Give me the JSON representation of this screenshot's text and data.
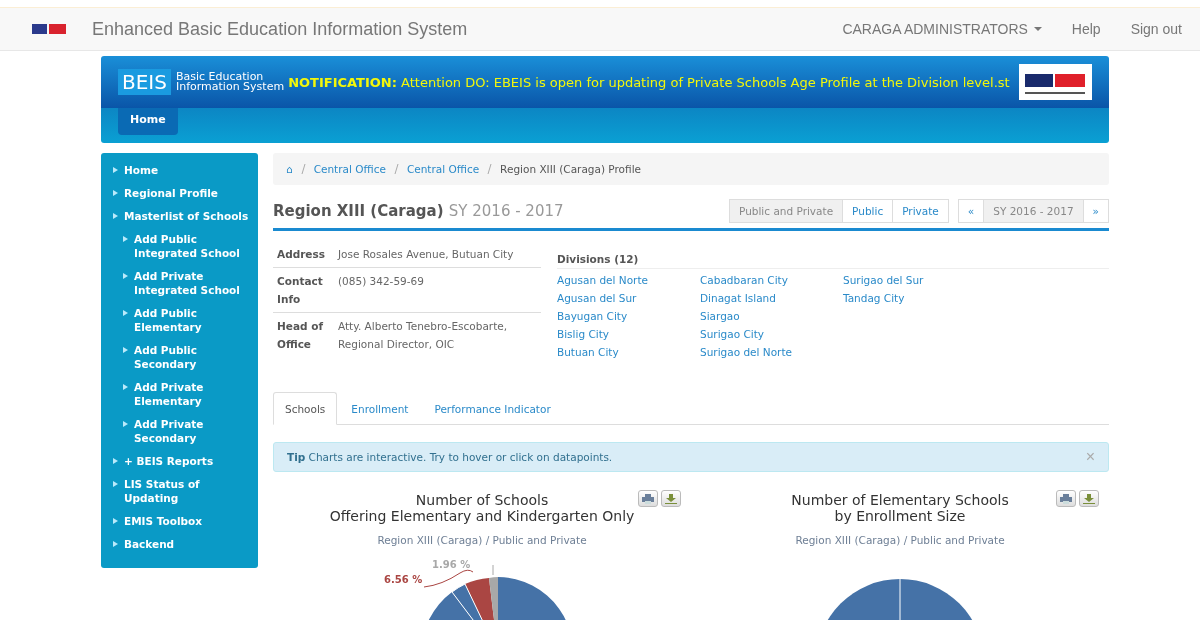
{
  "navbar": {
    "title": "Enhanced Basic Education Information System",
    "user_menu": "CARAGA ADMINISTRATORS",
    "links": [
      "Help",
      "Sign out"
    ]
  },
  "banner": {
    "brand": "BEIS",
    "brand_subtitle": [
      "Basic Education",
      "Information System"
    ],
    "notification": "**NOTIFICATION:** Attention DO: EBEIS is open for updating of Private Schools Age Profile at the Division level.st",
    "nav": [
      {
        "label": "Home",
        "selected": true
      }
    ]
  },
  "sidebar": {
    "items": [
      {
        "label": "Home"
      },
      {
        "label": "Regional Profile"
      },
      {
        "label": "Masterlist of Schools",
        "children": [
          {
            "label": "Add Public Integrated School"
          },
          {
            "label": "Add Private Integrated School"
          },
          {
            "label": "Add Public Elementary"
          },
          {
            "label": "Add Public Secondary"
          },
          {
            "label": "Add Private Elementary"
          },
          {
            "label": "Add Private Secondary"
          }
        ]
      },
      {
        "label": "+ BEIS Reports"
      },
      {
        "label": "LIS Status of Updating"
      },
      {
        "label": "EMIS Toolbox"
      },
      {
        "label": "Backend"
      }
    ]
  },
  "breadcrumb": [
    "⌂",
    "Central Office",
    "Central Office",
    "Region XIII (Caraga) Profile"
  ],
  "heading": {
    "title": "Region XIII (Caraga)",
    "subtitle": "SY 2016 - 2017"
  },
  "sector_filter": [
    {
      "label": "Public and Private",
      "selected": true
    },
    {
      "label": "Public",
      "selected": false
    },
    {
      "label": "Private",
      "selected": false
    }
  ],
  "year_pager": {
    "prev": "«",
    "current": "SY 2016 - 2017",
    "next": "»"
  },
  "profile": [
    {
      "label": "Address",
      "value": "Jose Rosales Avenue, Butuan City"
    },
    {
      "label": "Contact Info",
      "value": "(085) 342-59-69"
    },
    {
      "label": "Head of Office",
      "value": "Atty. Alberto Tenebro-Escobarte, Regional Director, OIC"
    }
  ],
  "divisions": {
    "title": "Divisions (12)",
    "items": [
      "Agusan del Norte",
      "Agusan del Sur",
      "Bayugan City",
      "Bislig City",
      "Butuan City",
      "Cabadbaran City",
      "Dinagat Island",
      "Siargao",
      "Surigao City",
      "Surigao del Norte",
      "Surigao del Sur",
      "Tandag City"
    ]
  },
  "tabs": [
    {
      "label": "Schools",
      "selected": true
    },
    {
      "label": "Enrollment",
      "selected": false
    },
    {
      "label": "Performance Indicator",
      "selected": false
    }
  ],
  "tip": {
    "text": "**Tip** Charts are interactive. Try to hover or click on datapoints.",
    "close": "×"
  },
  "charts": [
    {
      "title": [
        "Number of Schools",
        "Offering Elementary and Kindergarten Only"
      ],
      "subtitle": "Region XIII (Caraga) / Public and Private",
      "labels": [
        {
          "text": "6.56 %",
          "color": "#aa4643"
        },
        {
          "text": "1.96 %",
          "color": "#a8a8a8"
        }
      ]
    },
    {
      "title": [
        "Number of Elementary Schools",
        "by Enrollment Size"
      ],
      "subtitle": "Region XIII (Caraga) / Public and Private"
    }
  ]
}
